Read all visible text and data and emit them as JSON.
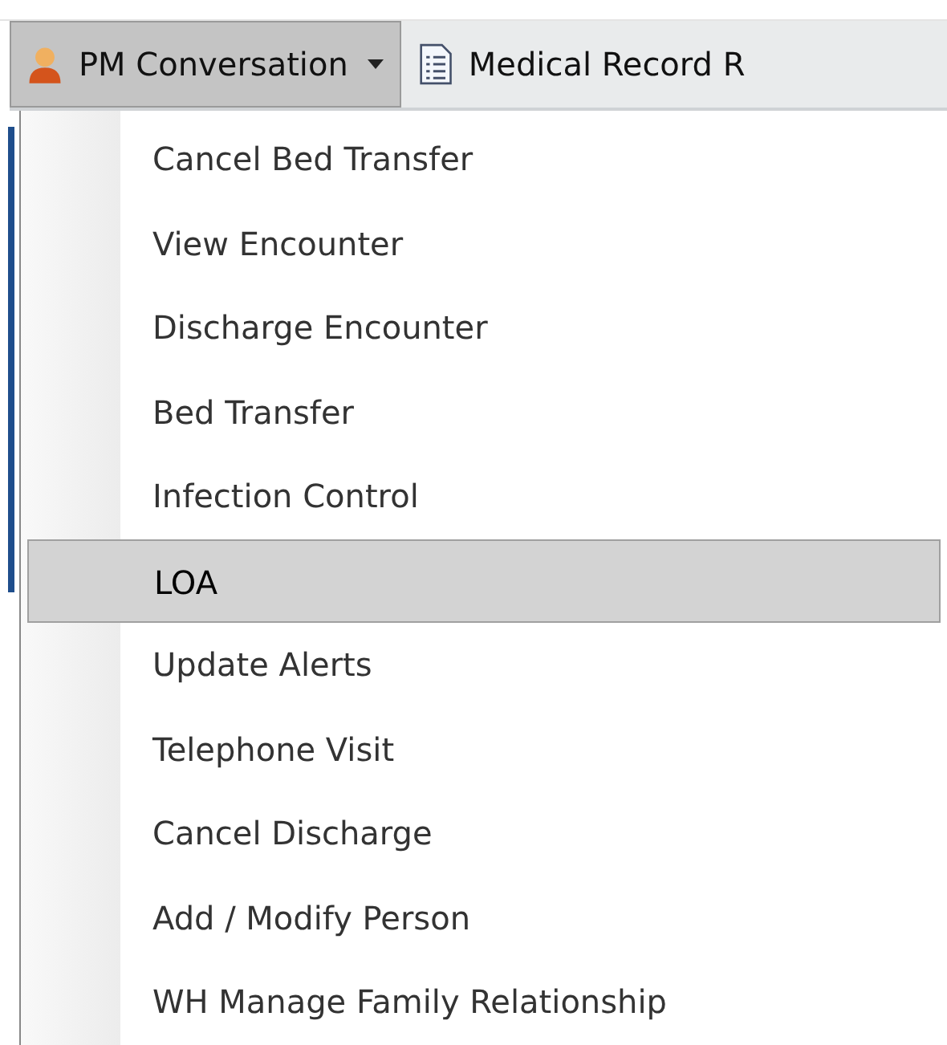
{
  "toolbar": {
    "buttons": [
      {
        "label": "PM Conversation",
        "kind": "dropdown",
        "pressed": true
      },
      {
        "label": "Medical Record R",
        "kind": "document",
        "pressed": false
      }
    ]
  },
  "menu": {
    "items": [
      {
        "label": "Cancel Bed Transfer",
        "selected": false
      },
      {
        "label": "View Encounter",
        "selected": false
      },
      {
        "label": "Discharge Encounter",
        "selected": false
      },
      {
        "label": "Bed Transfer",
        "selected": false
      },
      {
        "label": "Infection Control",
        "selected": false
      },
      {
        "label": "LOA",
        "selected": true
      },
      {
        "label": "Update Alerts",
        "selected": false
      },
      {
        "label": "Telephone Visit",
        "selected": false
      },
      {
        "label": "Cancel Discharge",
        "selected": false
      },
      {
        "label": "Add / Modify Person",
        "selected": false
      },
      {
        "label": "WH Manage Family Relationship",
        "selected": false
      }
    ]
  }
}
